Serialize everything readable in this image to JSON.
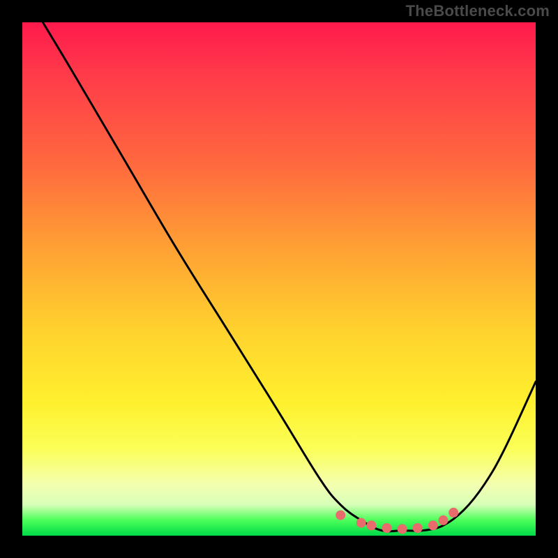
{
  "watermark": "TheBottleneck.com",
  "chart_data": {
    "type": "line",
    "title": "",
    "xlabel": "",
    "ylabel": "",
    "xlim": [
      0,
      100
    ],
    "ylim": [
      0,
      100
    ],
    "grid": false,
    "legend": false,
    "series": [
      {
        "name": "curve",
        "x": [
          4,
          10,
          20,
          30,
          40,
          50,
          58,
          62,
          66,
          70,
          74,
          78,
          82,
          86,
          90,
          94,
          100
        ],
        "values": [
          100,
          90,
          73,
          56,
          40,
          24,
          11,
          6,
          3,
          1,
          1,
          1,
          2,
          5,
          10,
          17,
          30
        ]
      }
    ],
    "markers": [
      {
        "x": 62,
        "y": 4.0
      },
      {
        "x": 66,
        "y": 2.5
      },
      {
        "x": 68,
        "y": 2.0
      },
      {
        "x": 71,
        "y": 1.5
      },
      {
        "x": 74,
        "y": 1.3
      },
      {
        "x": 77,
        "y": 1.5
      },
      {
        "x": 80,
        "y": 2.0
      },
      {
        "x": 82,
        "y": 3.0
      },
      {
        "x": 84,
        "y": 4.5
      }
    ],
    "marker_color": "#e86c6c",
    "curve_color": "#000000"
  }
}
